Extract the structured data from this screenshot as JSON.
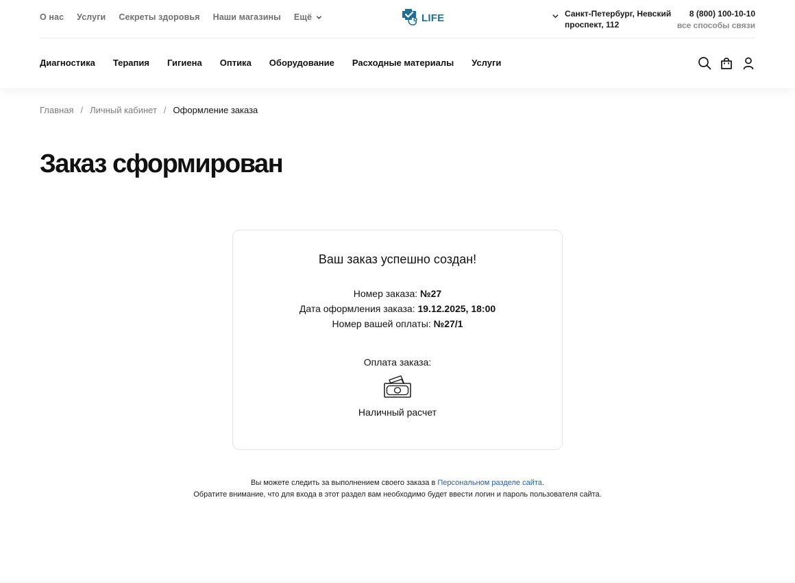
{
  "header": {
    "top_links": [
      "О нас",
      "Услуги",
      "Секреты здоровья",
      "Наши магазины"
    ],
    "more_label": "Ещё",
    "logo_text": "LIFE",
    "city": "Санкт-Петербург, Невский проспект, 112",
    "phone": "8 (800) 100-10-10",
    "all_contacts": "все способы связи",
    "nav": [
      "Диагностика",
      "Терапия",
      "Гигиена",
      "Оптика",
      "Оборудование",
      "Расходные материалы",
      "Услуги"
    ],
    "icons": [
      "search-icon",
      "bag-icon",
      "user-icon"
    ]
  },
  "breadcrumb": [
    "Главная",
    "Личный кабинет",
    "Оформление заказа"
  ],
  "page_title": "Заказ сформирован",
  "order": {
    "heading": "Ваш заказ успешно создан!",
    "number_label": "Номер заказа:",
    "number_value": "№27",
    "date_label": "Дата оформления заказа:",
    "date_value": "19.12.2025, 18:00",
    "payment_number_label": "Номер вашей оплаты:",
    "payment_number_value": "№27/1",
    "payment_label": "Оплата заказа:",
    "payment_icon": "cash-icon",
    "payment_method": "Наличный расчет"
  },
  "note": {
    "line1_prefix": "Вы можете следить за выполнением своего заказа в",
    "line1_link": "Персональном разделе сайта",
    "line1_suffix": ".",
    "line2": "Обратите внимание, что для входа в этот раздел вам необходимо будет ввести логин и пароль пользователя сайта."
  },
  "colors": {
    "brand": "#1f6f94",
    "link": "#1f5fae",
    "muted_text": "#7a7a7a"
  }
}
